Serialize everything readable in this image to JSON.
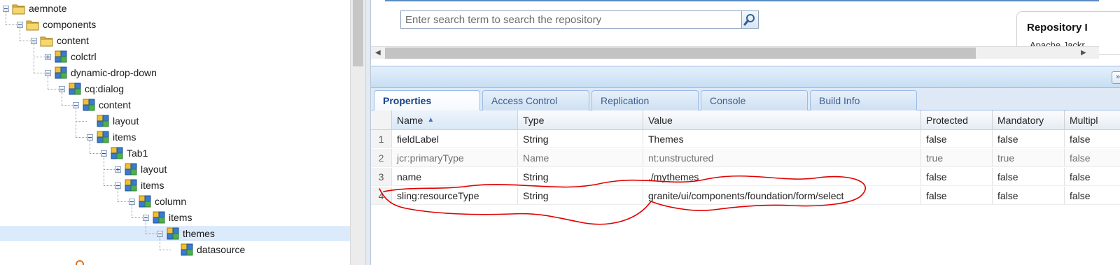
{
  "tree": {
    "nodes": [
      {
        "label": "aemnote",
        "icon": "folder-icon",
        "toggle": "expanded"
      },
      {
        "label": "components",
        "icon": "folder-icon",
        "toggle": "expanded"
      },
      {
        "label": "content",
        "icon": "folder-icon",
        "toggle": "expanded"
      },
      {
        "label": "colctrl",
        "icon": "component-node-icon",
        "toggle": "collapsed"
      },
      {
        "label": "dynamic-drop-down",
        "icon": "component-node-icon",
        "toggle": "expanded"
      },
      {
        "label": "cq:dialog",
        "icon": "component-node-icon",
        "toggle": "expanded"
      },
      {
        "label": "content",
        "icon": "component-node-icon",
        "toggle": "expanded"
      },
      {
        "label": "layout",
        "icon": "component-node-icon",
        "toggle": "none"
      },
      {
        "label": "items",
        "icon": "component-node-icon",
        "toggle": "expanded"
      },
      {
        "label": "Tab1",
        "icon": "component-node-icon",
        "toggle": "expanded"
      },
      {
        "label": "layout",
        "icon": "component-node-icon",
        "toggle": "collapsed"
      },
      {
        "label": "items",
        "icon": "component-node-icon",
        "toggle": "expanded"
      },
      {
        "label": "column",
        "icon": "component-node-icon",
        "toggle": "expanded"
      },
      {
        "label": "items",
        "icon": "component-node-icon",
        "toggle": "expanded"
      },
      {
        "label": "themes",
        "icon": "component-node-icon",
        "toggle": "expanded",
        "selected": true
      },
      {
        "label": "datasource",
        "icon": "component-node-icon",
        "toggle": "none"
      }
    ]
  },
  "search": {
    "placeholder": "Enter search term to search the repository"
  },
  "repository_panel": {
    "title": "Repository I",
    "subtitle": "Apache Jackr"
  },
  "tabs": [
    {
      "label": "Properties",
      "active": true
    },
    {
      "label": "Access Control"
    },
    {
      "label": "Replication"
    },
    {
      "label": "Console"
    },
    {
      "label": "Build Info"
    }
  ],
  "properties_grid": {
    "columns": [
      "Name",
      "Type",
      "Value",
      "Protected",
      "Mandatory",
      "Multipl"
    ],
    "rows": [
      {
        "num": "1",
        "name": "fieldLabel",
        "type": "String",
        "value": "Themes",
        "protected": "false",
        "mandatory": "false",
        "multiple": "false"
      },
      {
        "num": "2",
        "name": "jcr:primaryType",
        "type": "Name",
        "value": "nt:unstructured",
        "protected": "true",
        "mandatory": "true",
        "multiple": "false",
        "gray": true
      },
      {
        "num": "3",
        "name": "name",
        "type": "String",
        "value": "./mythemes",
        "protected": "false",
        "mandatory": "false",
        "multiple": "false"
      },
      {
        "num": "4",
        "name": "sling:resourceType",
        "type": "String",
        "value": "granite/ui/components/foundation/form/select",
        "protected": "false",
        "mandatory": "false",
        "multiple": "false"
      }
    ]
  },
  "colors": {
    "accent": "#99bbe8",
    "selection": "#dcebfb",
    "annotation": "#e00000"
  }
}
